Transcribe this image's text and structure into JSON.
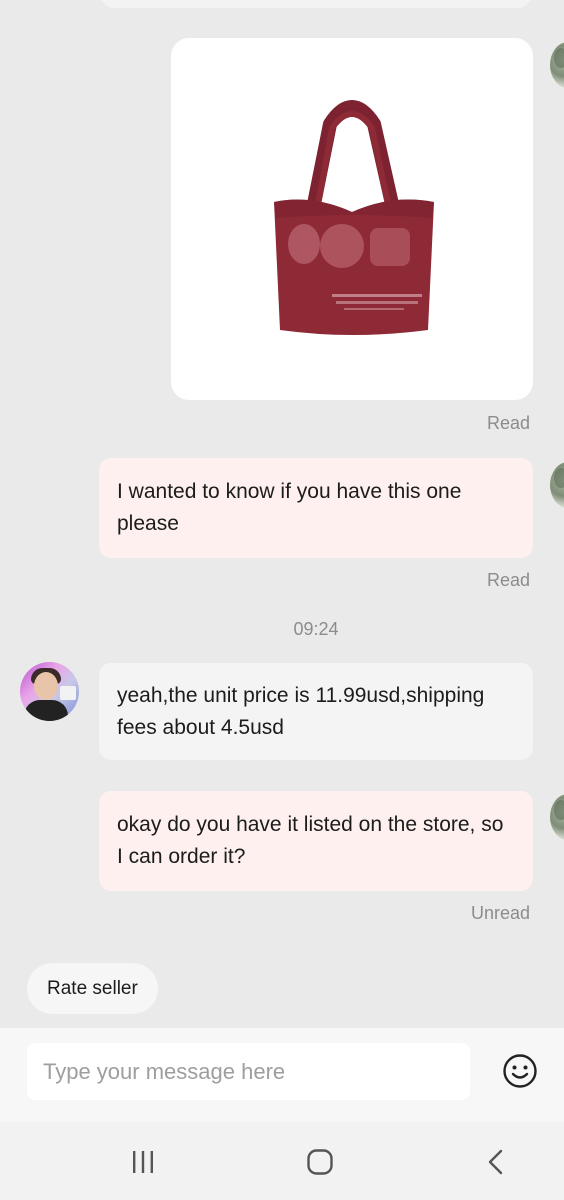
{
  "messages": [
    {
      "status": "Read"
    },
    {
      "text": "I wanted to know if you have this one please",
      "status": "Read"
    },
    {
      "text": "yeah,the unit price is 11.99usd,shipping fees about 4.5usd"
    },
    {
      "text": "okay do you have it listed on the store, so I can order it?",
      "status": "Unread"
    }
  ],
  "timestamp": "09:24",
  "rate_seller_label": "Rate seller",
  "composer": {
    "placeholder": "Type your message here",
    "value": ""
  },
  "icons": {
    "emoji": "smiley-face-icon",
    "recents": "recent-apps-icon",
    "home": "home-icon",
    "back": "back-icon"
  },
  "colors": {
    "outgoing_bubble": "#fdf0ef",
    "incoming_bubble": "#f4f4f4",
    "background": "#eaeaea",
    "bag": "#8e2a35"
  }
}
